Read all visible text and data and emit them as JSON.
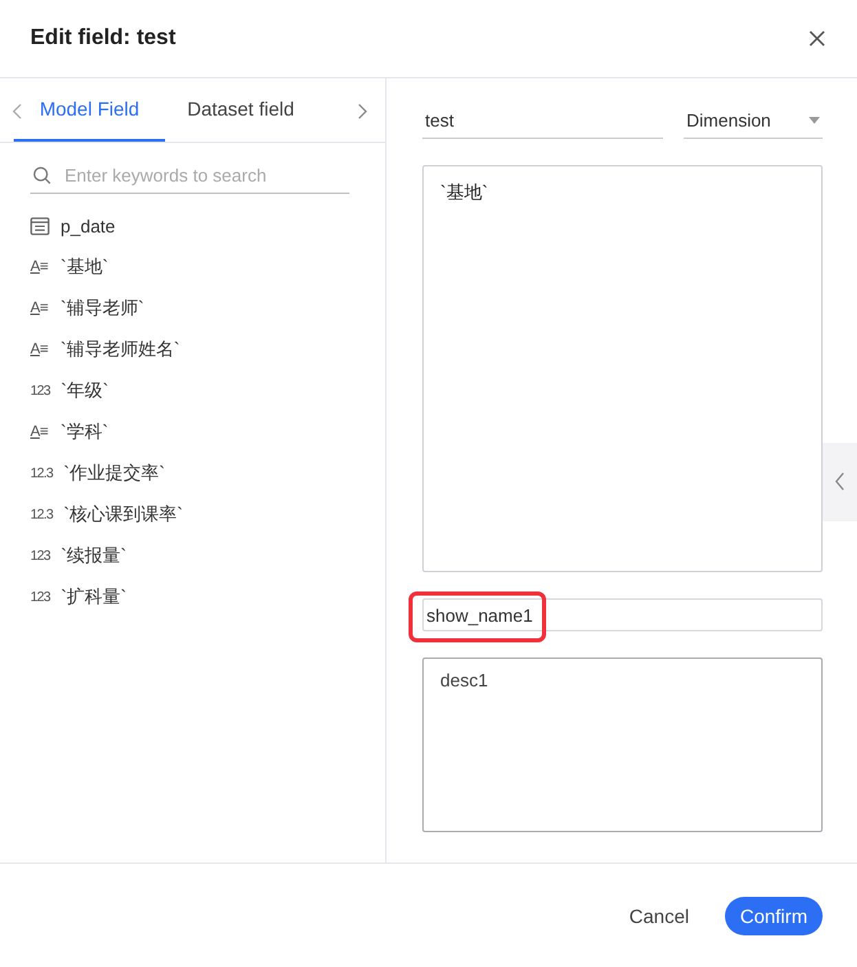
{
  "dialog": {
    "title": "Edit field: test"
  },
  "tabs": [
    {
      "label": "Model Field",
      "selected": true
    },
    {
      "label": "Dataset field",
      "selected": false
    }
  ],
  "search": {
    "placeholder": "Enter keywords to search"
  },
  "fields": [
    {
      "kind": "date",
      "name": "p_date"
    },
    {
      "kind": "text",
      "type_label": "A≡",
      "name": "`基地`"
    },
    {
      "kind": "text",
      "type_label": "A≡",
      "name": "`辅导老师`"
    },
    {
      "kind": "text",
      "type_label": "A≡",
      "name": "`辅导老师姓名`"
    },
    {
      "kind": "number",
      "type_label": "123",
      "name": "`年级`"
    },
    {
      "kind": "text",
      "type_label": "A≡",
      "name": "`学科`"
    },
    {
      "kind": "number",
      "type_label": "12.3",
      "name": "`作业提交率`"
    },
    {
      "kind": "number",
      "type_label": "12.3",
      "name": "`核心课到课率`"
    },
    {
      "kind": "number",
      "type_label": "123",
      "name": "`续报量`"
    },
    {
      "kind": "number",
      "type_label": "123",
      "name": "`扩科量`"
    }
  ],
  "form": {
    "name": "test",
    "role": "Dimension",
    "expression": "`基地`",
    "show_name": {
      "value": "show_name1",
      "highlighted": true
    },
    "description": "desc1"
  },
  "buttons": [
    {
      "label": "Cancel",
      "kind": "secondary"
    },
    {
      "label": "Confirm",
      "kind": "primary"
    }
  ]
}
